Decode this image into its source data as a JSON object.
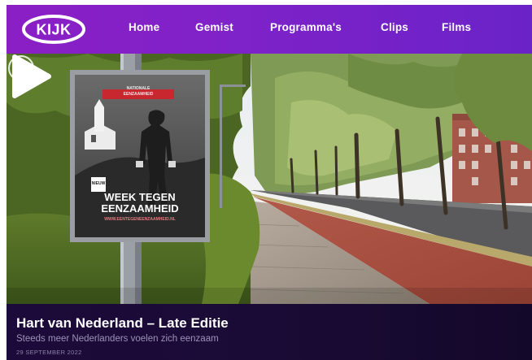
{
  "brand": {
    "logo_text": "KIJK",
    "logo_icon": "kijk-logo-icon"
  },
  "nav": {
    "items": [
      {
        "label": "Home"
      },
      {
        "label": "Gemist"
      },
      {
        "label": "Programma's"
      },
      {
        "label": "Clips"
      },
      {
        "label": "Films"
      }
    ]
  },
  "hero": {
    "poster": {
      "top_label": "NATIONALE",
      "headline_small": "EENZAAMHEID",
      "headline_line1": "WEEK TEGEN",
      "headline_line2": "EENZAAMHEID",
      "tagline": "WWW.EENTEGENEENZAAMHEID.NL",
      "sticker": "NIEUW"
    },
    "play_icon": "play-icon",
    "channel_icon": "channel-logo-icon"
  },
  "episode": {
    "title": "Hart van Nederland – Late Editie",
    "subtitle": "Steeds meer Nederlanders voelen zich eenzaam",
    "date": "29 SEPTEMBER 2022"
  },
  "colors": {
    "nav_start": "#8a1fc4",
    "nav_end": "#6a23c7",
    "info_bg": "#1c0a3a",
    "subtitle": "#9c92b8"
  }
}
